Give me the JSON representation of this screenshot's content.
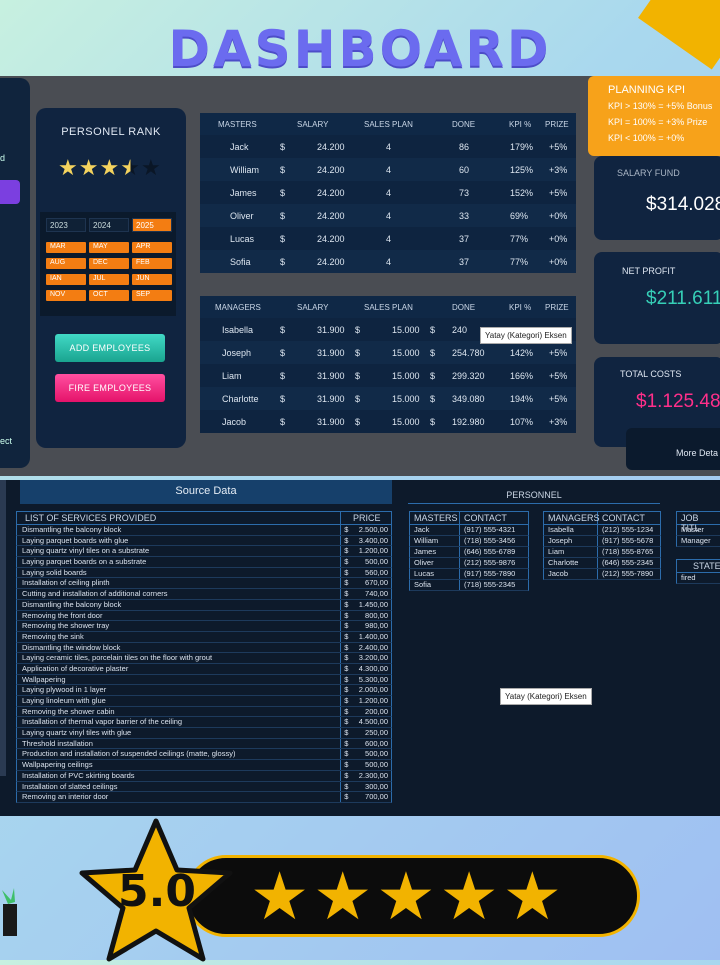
{
  "title": "DASHBOARD",
  "left_tab": {
    "text_top": "d",
    "text_bottom": "ect"
  },
  "rank": {
    "title": "PERSONEL RANK",
    "stars_full": 3,
    "stars_half": 1,
    "stars_empty": 1
  },
  "calendar": {
    "years": [
      "2023",
      "2024",
      "2025"
    ],
    "selected_year": "2025",
    "months": [
      "MAR",
      "MAY",
      "APR",
      "AUG",
      "DEC",
      "FEB",
      "IAN",
      "JUL",
      "JUN",
      "NOV",
      "OCT",
      "SEP"
    ]
  },
  "buttons": {
    "add": "ADD EMPLOYEES",
    "fire": "FIRE EMPLOYEES"
  },
  "masters": {
    "headers": [
      "MASTERS",
      "SALARY",
      "SALES PLAN",
      "DONE",
      "KPI %",
      "PRIZE"
    ],
    "rows": [
      {
        "name": "Jack",
        "cur": "$",
        "salary": "24.200",
        "plan": "4",
        "done": "86",
        "kpi": "179%",
        "prize": "+5%"
      },
      {
        "name": "William",
        "cur": "$",
        "salary": "24.200",
        "plan": "4",
        "done": "60",
        "kpi": "125%",
        "prize": "+3%"
      },
      {
        "name": "James",
        "cur": "$",
        "salary": "24.200",
        "plan": "4",
        "done": "73",
        "kpi": "152%",
        "prize": "+5%"
      },
      {
        "name": "Oliver",
        "cur": "$",
        "salary": "24.200",
        "plan": "4",
        "done": "33",
        "kpi": "69%",
        "prize": "+0%"
      },
      {
        "name": "Lucas",
        "cur": "$",
        "salary": "24.200",
        "plan": "4",
        "done": "37",
        "kpi": "77%",
        "prize": "+0%"
      },
      {
        "name": "Sofia",
        "cur": "$",
        "salary": "24.200",
        "plan": "4",
        "done": "37",
        "kpi": "77%",
        "prize": "+0%"
      }
    ]
  },
  "managers": {
    "headers": [
      "MANAGERS",
      "SALARY",
      "SALES PLAN",
      "DONE",
      "KPI %",
      "PRIZE"
    ],
    "rows": [
      {
        "name": "Isabella",
        "cur": "$",
        "salary": "31.900",
        "cur2": "$",
        "plan": "15.000",
        "cur3": "$",
        "done": "240",
        "kpi": "",
        "prize": ""
      },
      {
        "name": "Joseph",
        "cur": "$",
        "salary": "31.900",
        "cur2": "$",
        "plan": "15.000",
        "cur3": "$",
        "done": "254.780",
        "kpi": "142%",
        "prize": "+5%"
      },
      {
        "name": "Liam",
        "cur": "$",
        "salary": "31.900",
        "cur2": "$",
        "plan": "15.000",
        "cur3": "$",
        "done": "299.320",
        "kpi": "166%",
        "prize": "+5%"
      },
      {
        "name": "Charlotte",
        "cur": "$",
        "salary": "31.900",
        "cur2": "$",
        "plan": "15.000",
        "cur3": "$",
        "done": "349.080",
        "kpi": "194%",
        "prize": "+5%"
      },
      {
        "name": "Jacob",
        "cur": "$",
        "salary": "31.900",
        "cur2": "$",
        "plan": "15.000",
        "cur3": "$",
        "done": "192.980",
        "kpi": "107%",
        "prize": "+3%"
      }
    ]
  },
  "tooltip": "Yatay (Kategori) Eksen",
  "kpi": {
    "title": "PLANNING KPI",
    "lines": [
      "KPI > 130% = +5% Bonus",
      "KPI = 100% = +3% Prize",
      "KPI < 100% = +0%"
    ]
  },
  "salary_fund": {
    "label": "SALARY FUND",
    "value": "$314.028"
  },
  "net_profit": {
    "label": "NET PROFIT",
    "value": "$211.611"
  },
  "total_costs": {
    "label": "TOTAL COSTS",
    "value": "$1.125.48"
  },
  "more": "More Deta",
  "source": {
    "title": "Source Data",
    "col_service": "LIST OF SERVICES PROVIDED",
    "col_price": "PRICE",
    "rows": [
      [
        "Dismantling the balcony block",
        "2.500,00"
      ],
      [
        "Laying parquet boards with glue",
        "3.400,00"
      ],
      [
        "Laying quartz vinyl tiles on a substrate",
        "1.200,00"
      ],
      [
        "Laying parquet boards on a substrate",
        "500,00"
      ],
      [
        "Laying solid boards",
        "560,00"
      ],
      [
        "Installation of ceiling plinth",
        "670,00"
      ],
      [
        "Cutting and installation of additional corners",
        "740,00"
      ],
      [
        "Dismantling the balcony block",
        "1.450,00"
      ],
      [
        "Removing the front door",
        "800,00"
      ],
      [
        "Removing the shower tray",
        "980,00"
      ],
      [
        "Removing the sink",
        "1.400,00"
      ],
      [
        "Dismantling the window block",
        "2.400,00"
      ],
      [
        "Laying ceramic tiles, porcelain tiles on the floor with grout",
        "3.200,00"
      ],
      [
        "Application of decorative plaster",
        "4.300,00"
      ],
      [
        "Wallpapering",
        "5.300,00"
      ],
      [
        "Laying plywood in 1 layer",
        "2.000,00"
      ],
      [
        "Laying linoleum with glue",
        "1.200,00"
      ],
      [
        "Removing the shower cabin",
        "200,00"
      ],
      [
        "Installation of thermal vapor barrier of the ceiling",
        "4.500,00"
      ],
      [
        "Laying quartz vinyl tiles with glue",
        "250,00"
      ],
      [
        "Threshold installation",
        "600,00"
      ],
      [
        "Production and installation of suspended ceilings (matte, glossy)",
        "500,00"
      ],
      [
        "Wallpapering ceilings",
        "500,00"
      ],
      [
        "Installation of PVC skirting boards",
        "2.300,00"
      ],
      [
        "Installation of slatted ceilings",
        "300,00"
      ],
      [
        "Removing an interior door",
        "700,00"
      ]
    ]
  },
  "personnel": {
    "title": "PERSONNEL",
    "masters_hdr": [
      "MASTERS",
      "CONTACT"
    ],
    "masters": [
      [
        "Jack",
        "(917) 555-4321"
      ],
      [
        "William",
        "(718) 555-3456"
      ],
      [
        "James",
        "(646) 555-6789"
      ],
      [
        "Oliver",
        "(212) 555-9876"
      ],
      [
        "Lucas",
        "(917) 555-7890"
      ],
      [
        "Sofia",
        "(718) 555-2345"
      ]
    ],
    "managers_hdr": [
      "MANAGERS",
      "CONTACT"
    ],
    "managers": [
      [
        "Isabella",
        "(212) 555-1234"
      ],
      [
        "Joseph",
        "(917) 555-5678"
      ],
      [
        "Liam",
        "(718) 555-8765"
      ],
      [
        "Charlotte",
        "(646) 555-2345"
      ],
      [
        "Jacob",
        "(212) 555-7890"
      ]
    ],
    "job_hdr": "JOB TITL",
    "jobs": [
      "Master",
      "Manager"
    ],
    "state_hdr": "STATE",
    "states": [
      "fired"
    ]
  },
  "rating": {
    "value": "5.0",
    "stars": 5
  },
  "colors": {
    "accent": "#6b6bef",
    "orange": "#f37d12",
    "teal": "#36cfb7",
    "pink": "#ff2f8a",
    "gold": "#f2b300"
  }
}
